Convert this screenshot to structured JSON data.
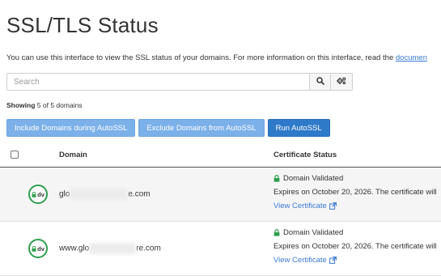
{
  "page": {
    "title": "SSL/TLS Status",
    "intro_text": "You can use this interface to view the SSL status of your domains. For more information on this interface, read the ",
    "intro_link": "documen"
  },
  "search": {
    "placeholder": "Search",
    "value": ""
  },
  "icons": {
    "search": "search-icon",
    "settings": "cogs-icon",
    "lock": "lock-icon",
    "external": "external-link-icon",
    "badge": "domain-validated-badge"
  },
  "showing": {
    "label": "Showing",
    "rest": "5 of 5 domains"
  },
  "actions": {
    "include": "Include Domains during AutoSSL",
    "exclude": "Exclude Domains from AutoSSL",
    "run": "Run AutoSSL"
  },
  "table": {
    "headers": {
      "domain": "Domain",
      "status": "Certificate Status"
    },
    "rows": [
      {
        "badge": "dv",
        "domain_prefix": "glo",
        "domain_suffix": "e.com",
        "status": "Domain Validated",
        "expires": "Expires on October 20, 2026. The certificate will",
        "view": "View Certificate"
      },
      {
        "badge": "dv",
        "domain_prefix": "www.glo",
        "domain_suffix": "re.com",
        "status": "Domain Validated",
        "expires": "Expires on October 20, 2026. The certificate will",
        "view": "View Certificate"
      }
    ]
  },
  "colors": {
    "accent": "#2f79c9",
    "accent_light": "#7cb0e8",
    "validated": "#2e9e4e",
    "link": "#3a7bd5"
  }
}
